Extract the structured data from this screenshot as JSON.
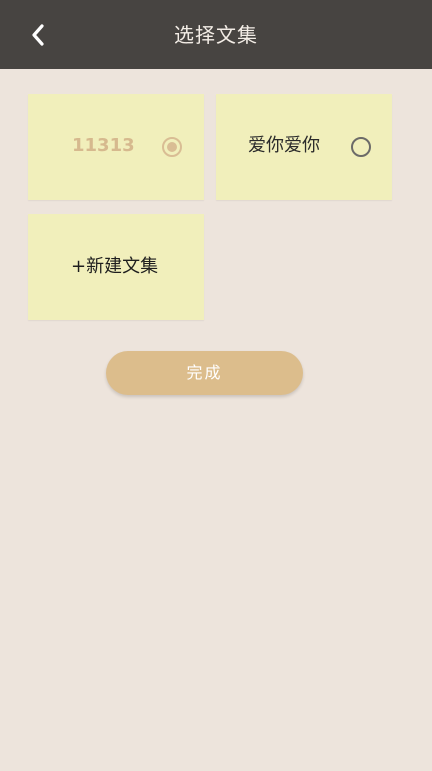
{
  "header": {
    "title": "选择文集",
    "back_icon": "chevron-left-icon"
  },
  "collections": [
    {
      "label": "11313",
      "selected": true
    },
    {
      "label": "爱你爱你",
      "selected": false
    }
  ],
  "new_collection": {
    "label": "+新建文集"
  },
  "done_button": {
    "label": "完成"
  },
  "colors": {
    "header_bg": "#474441",
    "page_bg": "#ede4dc",
    "card_bg": "#f1efbb",
    "accent": "#dcbd8c"
  }
}
